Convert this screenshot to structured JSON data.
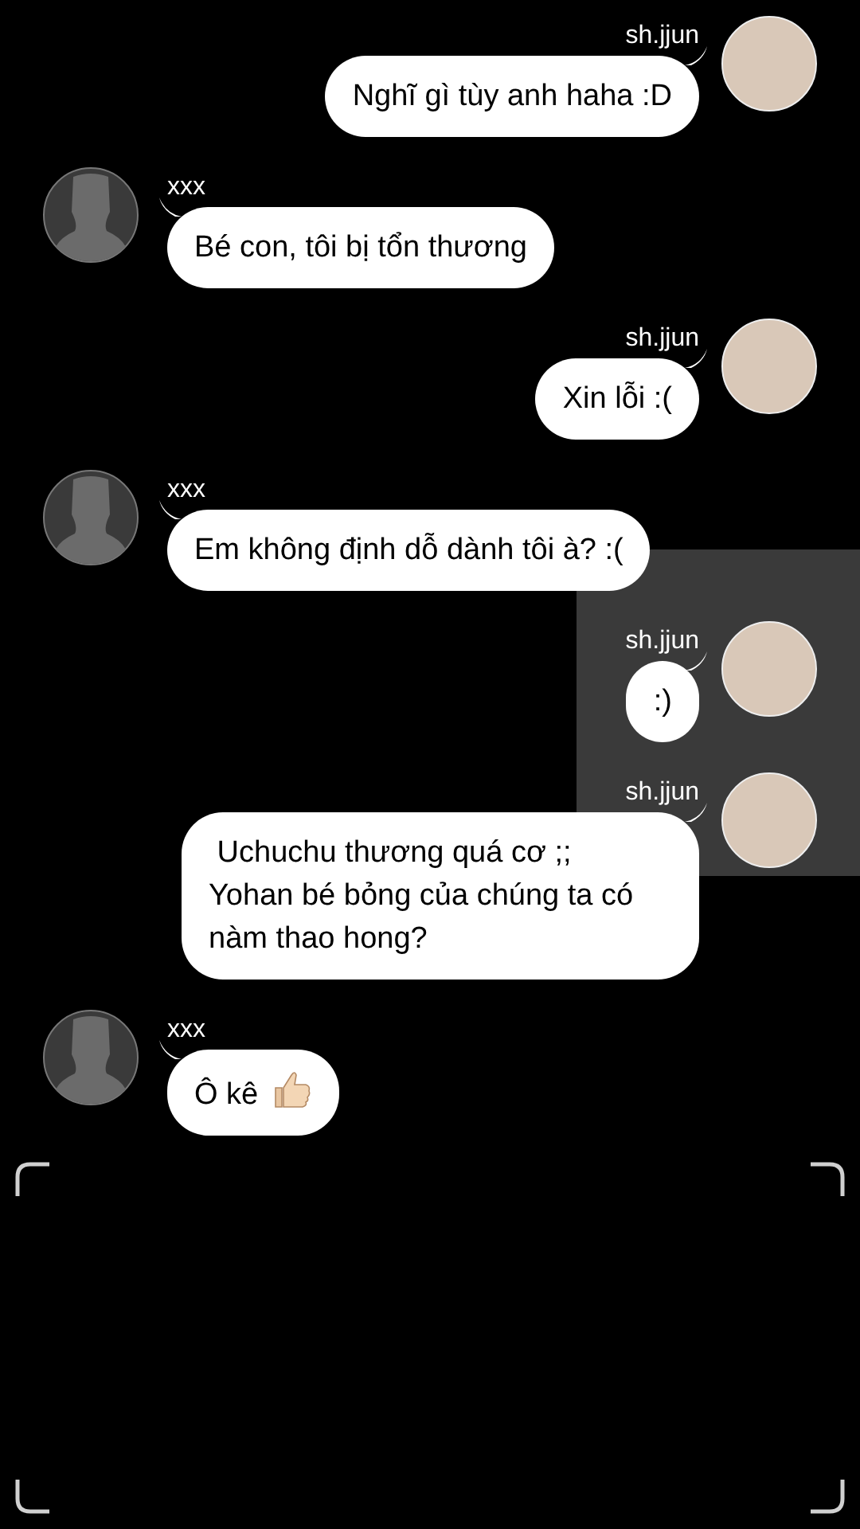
{
  "messages": [
    {
      "kind": "sent",
      "sender": "sh.jjun",
      "text": "Nghĩ gì tùy anh haha :D"
    },
    {
      "kind": "received",
      "sender": "xxx",
      "text": "Bé con, tôi bị tổn thương"
    },
    {
      "kind": "sent",
      "sender": "sh.jjun",
      "text": "Xin lỗi :("
    },
    {
      "kind": "received",
      "sender": "xxx",
      "text": "Em không định dỗ dành tôi à? :("
    },
    {
      "kind": "sent",
      "sender": "sh.jjun",
      "text": ":)"
    },
    {
      "kind": "sent",
      "sender": "sh.jjun",
      "text": " Uchuchu thương quá cơ ;;\nYohan bé bỏng của chúng ta có nàm thao hong?"
    },
    {
      "kind": "received",
      "sender": "xxx",
      "text": "Ô kê",
      "thumbs_up": true
    }
  ]
}
